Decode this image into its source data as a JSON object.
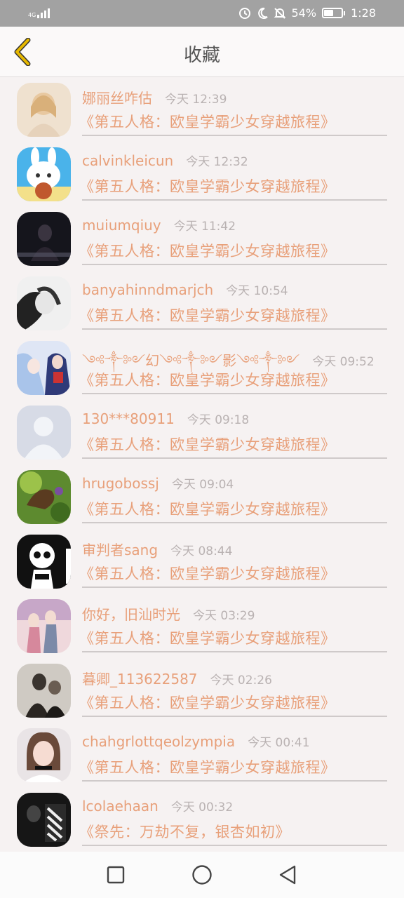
{
  "status_bar": {
    "network": "4G",
    "battery_percent": "54%",
    "battery_level": 0.54,
    "time": "1:28"
  },
  "header": {
    "title": "收藏",
    "back_icon": "chevron-left-icon"
  },
  "list": [
    {
      "name": "娜丽丝咋估",
      "time": "今天 12:39",
      "title": "《第五人格：欧皇学霸少女穿越旅程》"
    },
    {
      "name": "calvinkleicun",
      "time": "今天 12:32",
      "title": "《第五人格：欧皇学霸少女穿越旅程》"
    },
    {
      "name": "muiumqiuy",
      "time": "今天 11:42",
      "title": "《第五人格：欧皇学霸少女穿越旅程》"
    },
    {
      "name": "banyahinndmarjch",
      "time": "今天 10:54",
      "title": "《第五人格：欧皇学霸少女穿越旅程》"
    },
    {
      "name": "༺༒༻幻༺༒༻影༺༒༻",
      "time": "今天 09:52",
      "title": "《第五人格：欧皇学霸少女穿越旅程》"
    },
    {
      "name": "130***80911",
      "time": "今天 09:18",
      "title": "《第五人格：欧皇学霸少女穿越旅程》"
    },
    {
      "name": "hrugobossj",
      "time": "今天 09:04",
      "title": "《第五人格：欧皇学霸少女穿越旅程》"
    },
    {
      "name": "审判者sang",
      "time": "今天 08:44",
      "title": "《第五人格：欧皇学霸少女穿越旅程》"
    },
    {
      "name": "你好，旧汕时光",
      "time": "今天 03:29",
      "title": "《第五人格：欧皇学霸少女穿越旅程》"
    },
    {
      "name": "暮卿_113622587",
      "time": "今天 02:26",
      "title": "《第五人格：欧皇学霸少女穿越旅程》"
    },
    {
      "name": "chahgrlottqeolzympia",
      "time": "今天 00:41",
      "title": "《第五人格：欧皇学霸少女穿越旅程》"
    },
    {
      "name": "lcolaehaan",
      "time": "今天 00:32",
      "title": "《祭先：万劫不复，银杏如初》"
    }
  ],
  "nav_bar": {
    "icons": [
      "recents-square-icon",
      "home-circle-icon",
      "back-triangle-icon"
    ]
  },
  "colors": {
    "accent": "#e8a07a",
    "status_bar": "#a2a2a2",
    "back_arrow": "#e6b800"
  }
}
